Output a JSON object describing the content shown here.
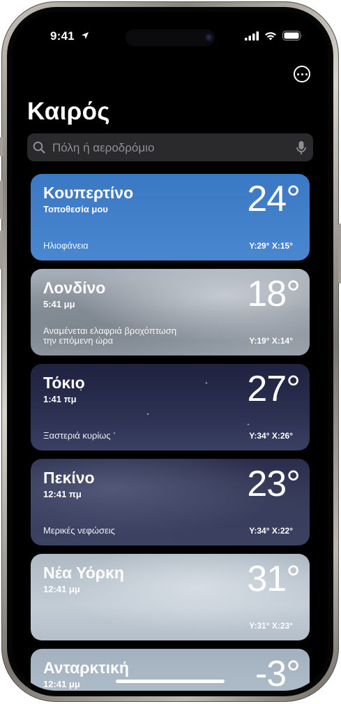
{
  "status": {
    "time": "9:41"
  },
  "app": {
    "title": "Καιρός"
  },
  "search": {
    "placeholder": "Πόλη ή αεροδρόμιο"
  },
  "cards": [
    {
      "city": "Κουπερτίνο",
      "sub": "Τοποθεσία μου",
      "temp": "24°",
      "cond": "Ηλιοφάνεια",
      "hl": "Υ:29° Χ:15°"
    },
    {
      "city": "Λονδίνο",
      "sub": "5:41 μμ",
      "temp": "18°",
      "cond": "Αναμένεται ελαφριά βροχόπτωση\nτην επόμενη ώρα",
      "hl": "Υ:19° Χ:14°"
    },
    {
      "city": "Τόκιο",
      "sub": "1:41 πμ",
      "temp": "27°",
      "cond": "Ξαστεριά κυρίως",
      "hl": "Υ:34° Χ:26°"
    },
    {
      "city": "Πεκίνο",
      "sub": "12:41 πμ",
      "temp": "23°",
      "cond": "Μερικές νεφώσεις",
      "hl": "Υ:34° Χ:22°"
    },
    {
      "city": "Νέα Υόρκη",
      "sub": "12:41 μμ",
      "temp": "31°",
      "cond": "",
      "hl": "Υ:31° Χ:23°"
    },
    {
      "city": "Ανταρκτική",
      "sub": "12:41 μμ",
      "temp": "-3°",
      "cond": "",
      "hl": ""
    }
  ],
  "colors": {
    "sunny": "#3a79c5",
    "cloudy": "#8f97a1",
    "night": "#2a2e4c",
    "sky": "#b9c4cf"
  }
}
